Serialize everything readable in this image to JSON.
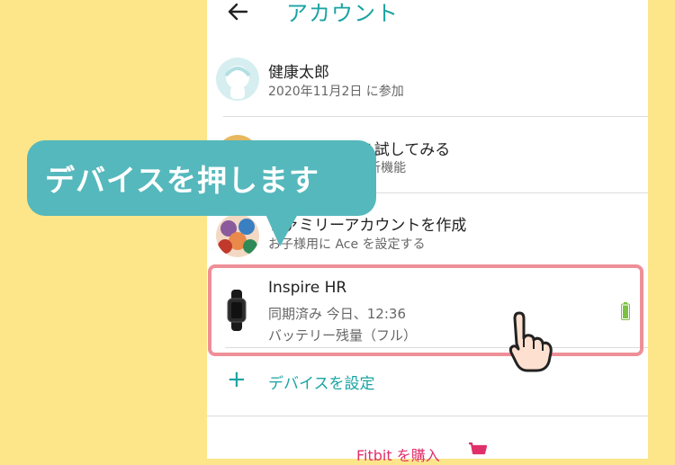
{
  "header": {
    "title": "アカウント"
  },
  "profile": {
    "name": "健康太郎",
    "joined": "2020年11月2日 に参加"
  },
  "premium": {
    "title": "…プレミアムを試してみる",
    "subtitle": "…ガイダンスと分析機能"
  },
  "family": {
    "title": "ファミリーアカウントを作成",
    "subtitle": "お子様用に Ace を設定する"
  },
  "device": {
    "name": "Inspire HR",
    "sync": "同期済み 今日、12:36",
    "battery": "バッテリー残量（フル）",
    "battery_level": 1.0
  },
  "add_device": {
    "label": "デバイスを設定"
  },
  "buy": {
    "label": "Fitbit を購入"
  },
  "callout": {
    "text": "デバイスを押します"
  },
  "colors": {
    "accent": "#1aa3a3",
    "highlight": "#ee8f97",
    "callout": "#55b8bc",
    "buy": "#e0306a",
    "battery": "#7cc242"
  }
}
